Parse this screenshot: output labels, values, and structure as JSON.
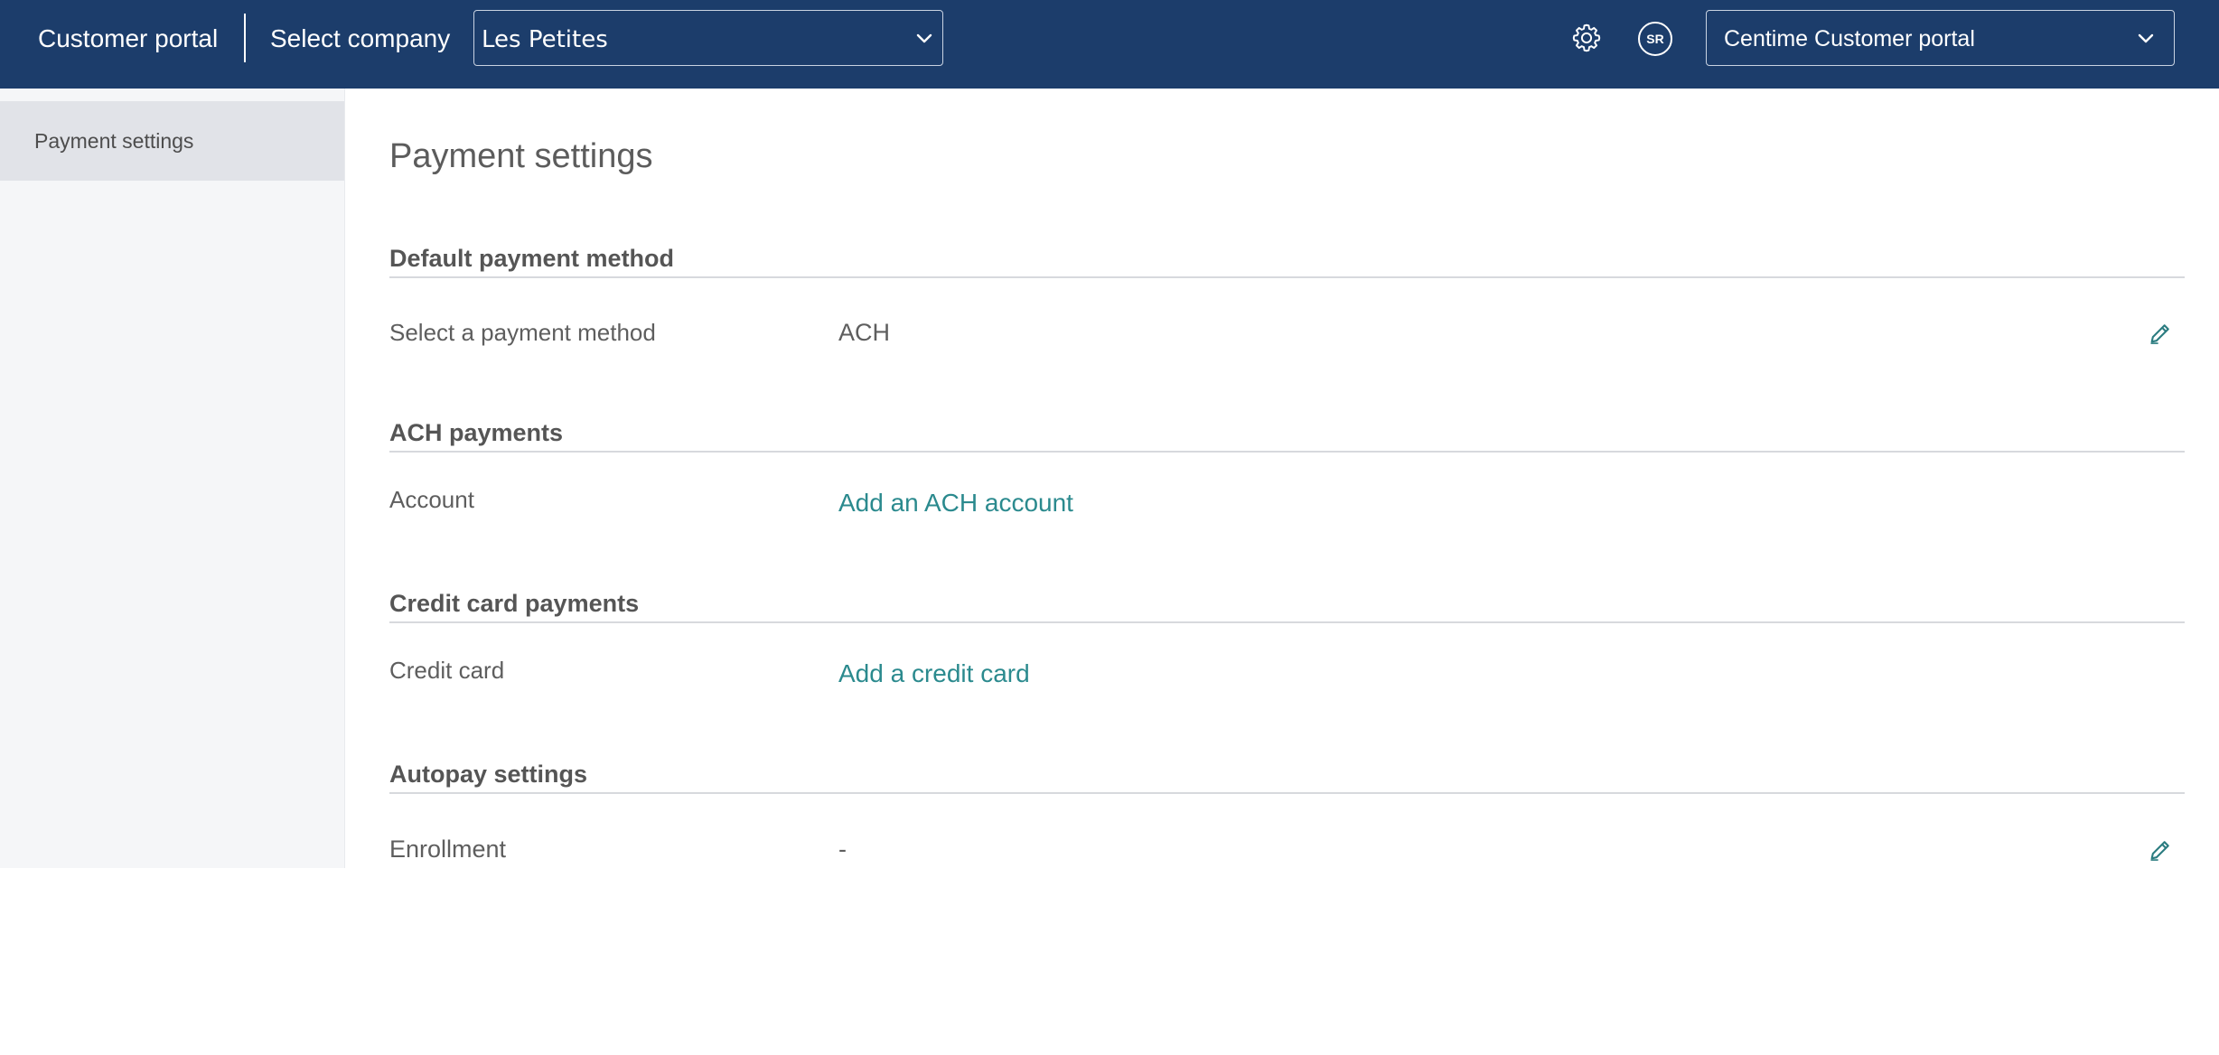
{
  "header": {
    "brand": "Customer portal",
    "select_company_label": "Select company",
    "company_selected": "Les Petites",
    "settings_icon": "gear-icon",
    "avatar_initials": "SR",
    "portal_selected": "Centime Customer portal",
    "bg_color": "#1c3d6b"
  },
  "sidebar": {
    "items": [
      {
        "label": "Payment settings",
        "active": true
      }
    ]
  },
  "main": {
    "title": "Payment settings",
    "sections": [
      {
        "heading": "Default payment method",
        "field_label": "Select a payment method",
        "field_value": "ACH"
      },
      {
        "heading": "ACH payments",
        "field_label": "Account",
        "field_link": "Add an ACH account"
      },
      {
        "heading": "Credit card payments",
        "field_label": "Credit card",
        "field_link": "Add a credit card"
      },
      {
        "heading": "Autopay settings",
        "field_label": "Enrollment",
        "field_value": "-"
      }
    ],
    "link_color": "#2b8a8e"
  }
}
